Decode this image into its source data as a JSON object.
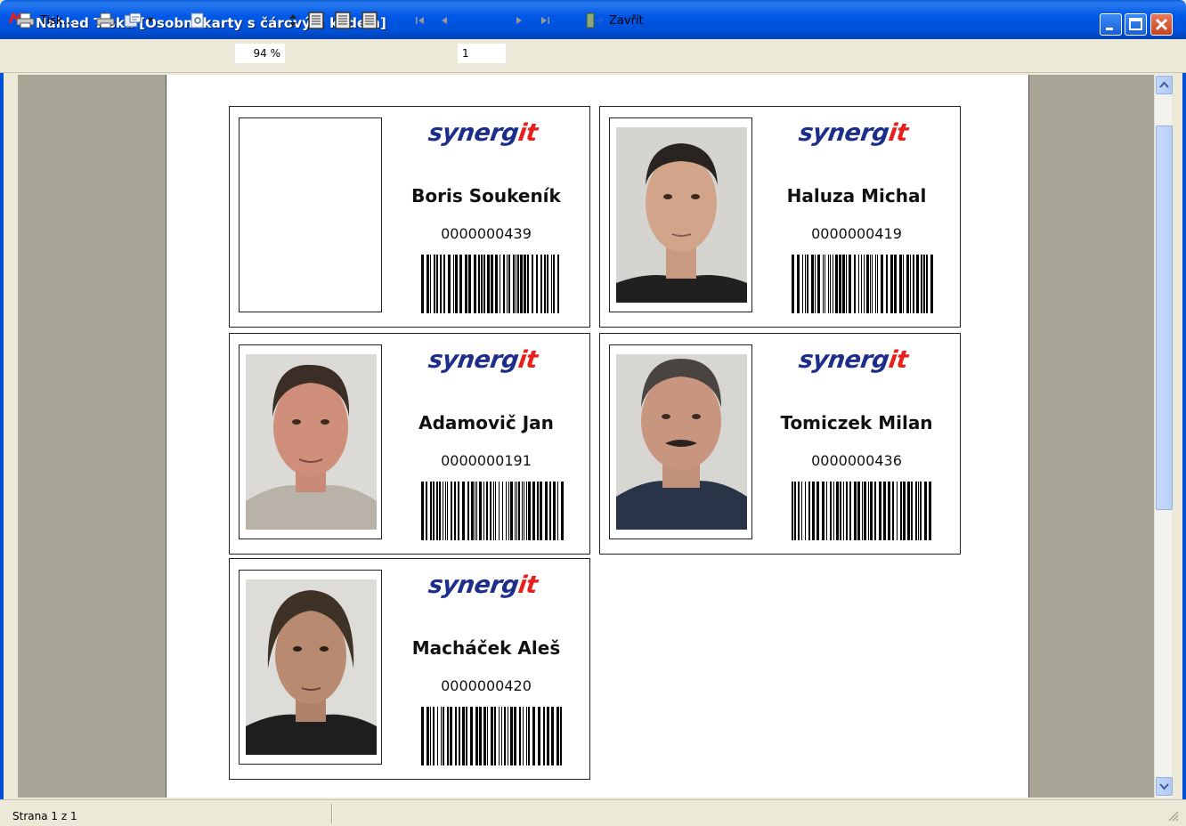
{
  "window": {
    "title": "Náhled Tisku [Osobní karty s čárovým kódem]"
  },
  "toolbar": {
    "print_label": "Tisk...",
    "zoom_value": "94 %",
    "page_value": "1",
    "close_label": "Zavřít"
  },
  "cards": [
    {
      "logo_main": "synerg",
      "logo_accent": "it",
      "name": "Boris Soukeník",
      "code": "0000000439",
      "has_photo": false
    },
    {
      "logo_main": "synerg",
      "logo_accent": "it",
      "name": "Haluza Michal",
      "code": "0000000419",
      "has_photo": true
    },
    {
      "logo_main": "synerg",
      "logo_accent": "it",
      "name": "Adamovič Jan",
      "code": "0000000191",
      "has_photo": true
    },
    {
      "logo_main": "synerg",
      "logo_accent": "it",
      "name": "Tomiczek Milan",
      "code": "0000000436",
      "has_photo": true
    },
    {
      "logo_main": "synerg",
      "logo_accent": "it",
      "name": "Macháček Aleš",
      "code": "0000000420",
      "has_photo": true
    }
  ],
  "statusbar": {
    "page_info": "Strana 1 z 1"
  },
  "colors": {
    "logo_blue": "#1c2d8a",
    "logo_red": "#e8201c",
    "title_blue": "#0058e6"
  }
}
